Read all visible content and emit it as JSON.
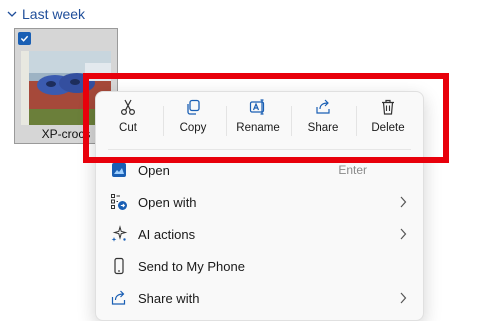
{
  "group": {
    "label": "Last week"
  },
  "file": {
    "name": "XP-crocs",
    "selected": true
  },
  "quick_actions": [
    {
      "label": "Cut",
      "icon": "scissors-icon"
    },
    {
      "label": "Copy",
      "icon": "copy-icon"
    },
    {
      "label": "Rename",
      "icon": "rename-icon"
    },
    {
      "label": "Share",
      "icon": "share-icon"
    },
    {
      "label": "Delete",
      "icon": "trash-icon"
    }
  ],
  "menu_items": [
    {
      "label": "Open",
      "icon": "open-icon",
      "shortcut": "Enter"
    },
    {
      "label": "Open with",
      "icon": "open-with-icon",
      "submenu": true
    },
    {
      "label": "AI actions",
      "icon": "sparkle-icon",
      "submenu": true
    },
    {
      "label": "Send to My Phone",
      "icon": "phone-icon"
    },
    {
      "label": "Share with",
      "icon": "share-with-icon",
      "submenu": true
    }
  ],
  "colors": {
    "accent": "#1a5fb4",
    "header_text": "#1f4e9a",
    "highlight": "#e8000b"
  }
}
